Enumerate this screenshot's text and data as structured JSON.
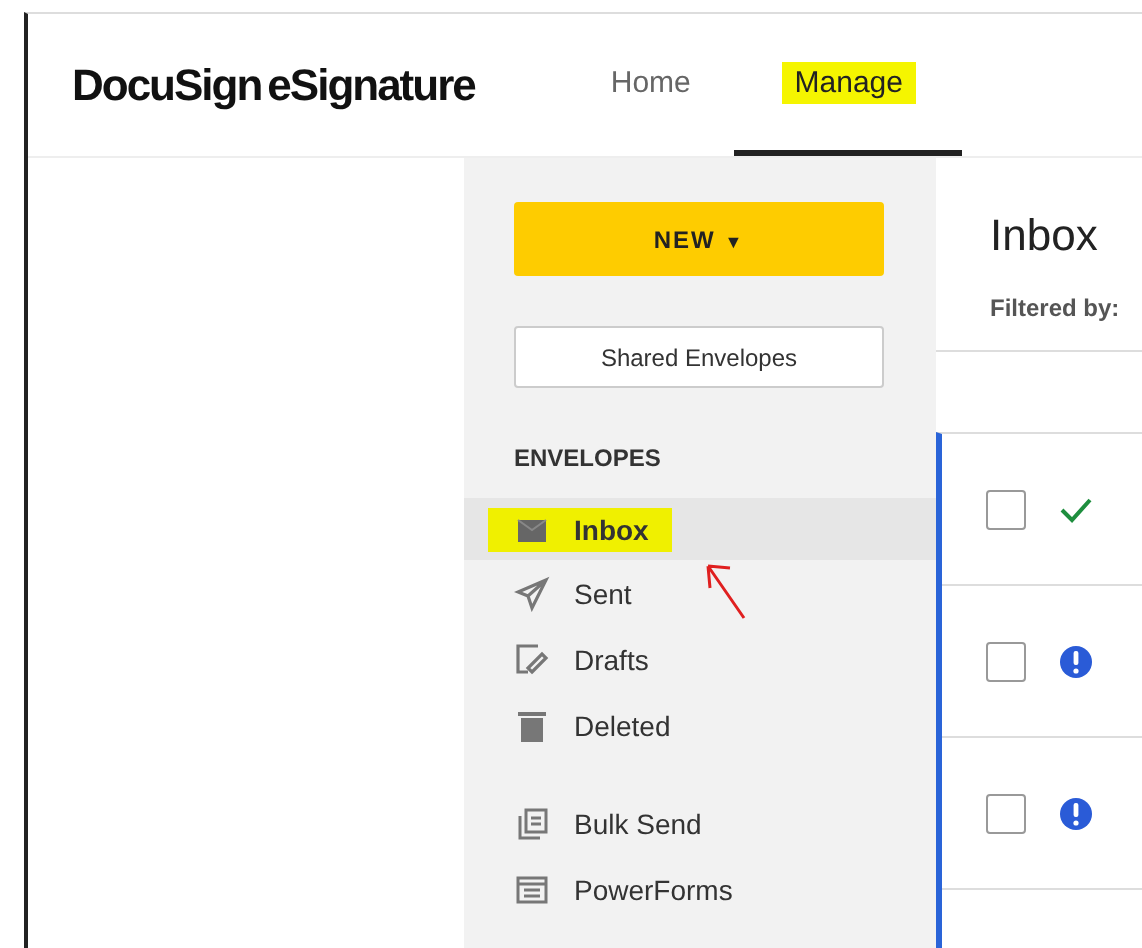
{
  "header": {
    "logo": "DocuSign",
    "logo_suffix": "eSignature",
    "nav": [
      {
        "label": "Home",
        "selected": false,
        "highlighted": false
      },
      {
        "label": "Manage",
        "selected": true,
        "highlighted": true
      }
    ]
  },
  "sidebar": {
    "new_button": "NEW",
    "new_caret": "▼",
    "shared_button": "Shared Envelopes",
    "section": "ENVELOPES",
    "items": [
      {
        "label": "Inbox",
        "kind": "inbox",
        "selected": true,
        "highlighted": true
      },
      {
        "label": "Sent",
        "kind": "sent",
        "selected": false,
        "highlighted": false
      },
      {
        "label": "Drafts",
        "kind": "drafts",
        "selected": false,
        "highlighted": false
      },
      {
        "label": "Deleted",
        "kind": "deleted",
        "selected": false,
        "highlighted": false
      }
    ],
    "tools": [
      {
        "label": "Bulk Send",
        "kind": "bulk",
        "selected": false,
        "highlighted": false
      },
      {
        "label": "PowerForms",
        "kind": "powerforms",
        "selected": false,
        "highlighted": false
      }
    ]
  },
  "main": {
    "title": "Inbox",
    "filter_label": "Filtered by:",
    "rows": [
      {
        "checked": false,
        "kind": "completed"
      },
      {
        "checked": false,
        "kind": "action"
      },
      {
        "checked": false,
        "kind": "action"
      }
    ]
  },
  "annotation": {
    "arrow": true
  }
}
